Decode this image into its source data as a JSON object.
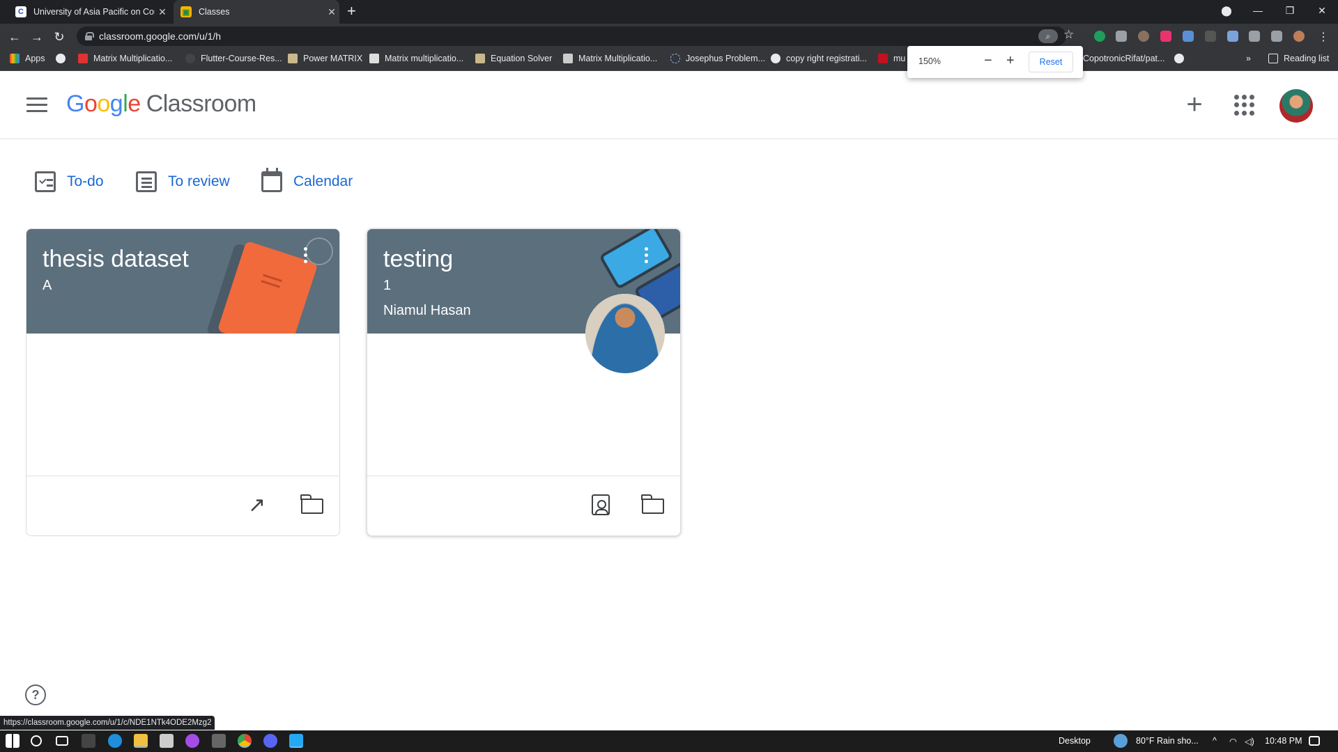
{
  "browser": {
    "tabs": [
      {
        "title": "University of Asia Pacific on Cour",
        "favicon": "coursera-icon",
        "active": false
      },
      {
        "title": "Classes",
        "favicon": "classroom-icon",
        "active": true
      }
    ],
    "url": "classroom.google.com/u/1/h",
    "bookmarks": [
      {
        "label": "Apps"
      },
      {
        "label": ""
      },
      {
        "label": "Matrix Multiplicatio..."
      },
      {
        "label": "Flutter-Course-Res..."
      },
      {
        "label": "Power MATRIX"
      },
      {
        "label": "Matrix multiplicatio..."
      },
      {
        "label": "Equation Solver"
      },
      {
        "label": "Matrix Multiplicatio..."
      },
      {
        "label": "Josephus Problem..."
      },
      {
        "label": "copy right registrati..."
      },
      {
        "label": "mu"
      },
      {
        "label": "CopotronicRifat/pat..."
      }
    ],
    "reading_list": "Reading list",
    "zoom_popup": {
      "value": "150%",
      "minus": "−",
      "plus": "+",
      "reset": "Reset"
    },
    "status_url": "https://classroom.google.com/u/1/c/NDE1NTk4ODE2Mzg2"
  },
  "header": {
    "logo": {
      "g": "G",
      "o1": "o",
      "o2": "o",
      "g2": "g",
      "l": "l",
      "e": "e",
      "product": "Classroom"
    }
  },
  "nav_links": [
    {
      "label": "To-do",
      "icon": "todo-icon"
    },
    {
      "label": "To review",
      "icon": "review-icon"
    },
    {
      "label": "Calendar",
      "icon": "calendar-icon"
    }
  ],
  "classes": [
    {
      "name": "thesis dataset",
      "section": "A",
      "teacher": "",
      "banner_color": "#5b6f7d",
      "footer_icons": [
        "trending-up-icon",
        "folder-icon"
      ]
    },
    {
      "name": "testing",
      "section": "1",
      "teacher": "Niamul Hasan",
      "banner_color": "#5b6f7d",
      "footer_icons": [
        "your-work-icon",
        "folder-icon"
      ]
    }
  ],
  "taskbar": {
    "desktop_label": "Desktop",
    "weather": "80°F  Rain sho...",
    "time": "10:48 PM"
  },
  "colors": {
    "accent": "#1967d2",
    "banner": "#5b6f7d",
    "chrome_dark": "#202124"
  }
}
